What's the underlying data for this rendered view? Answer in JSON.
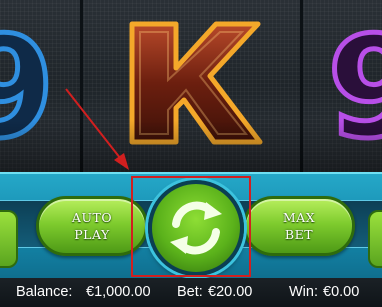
{
  "reels": {
    "symbols": [
      "9",
      "K",
      "9"
    ],
    "symbol_colors": {
      "left_nine": "#2f8fe0",
      "king_fill": "#8a2b13",
      "king_outline": "#f4a82a",
      "right_nine": "#b84fe8"
    }
  },
  "controls": {
    "auto_play_label": "AUTO\nPLAY",
    "max_bet_label": "MAX\nBET",
    "spin_icon": "refresh-arrows-icon",
    "button_color": "#7fcc2e"
  },
  "status": {
    "balance_label": "Balance:",
    "balance_value": "€1,000.00",
    "bet_label": "Bet:",
    "bet_value": "€20.00",
    "win_label": "Win:",
    "win_value": "€0.00"
  },
  "annotation": {
    "arrow_color": "#d21f1f",
    "highlight_target": "spin-button"
  }
}
